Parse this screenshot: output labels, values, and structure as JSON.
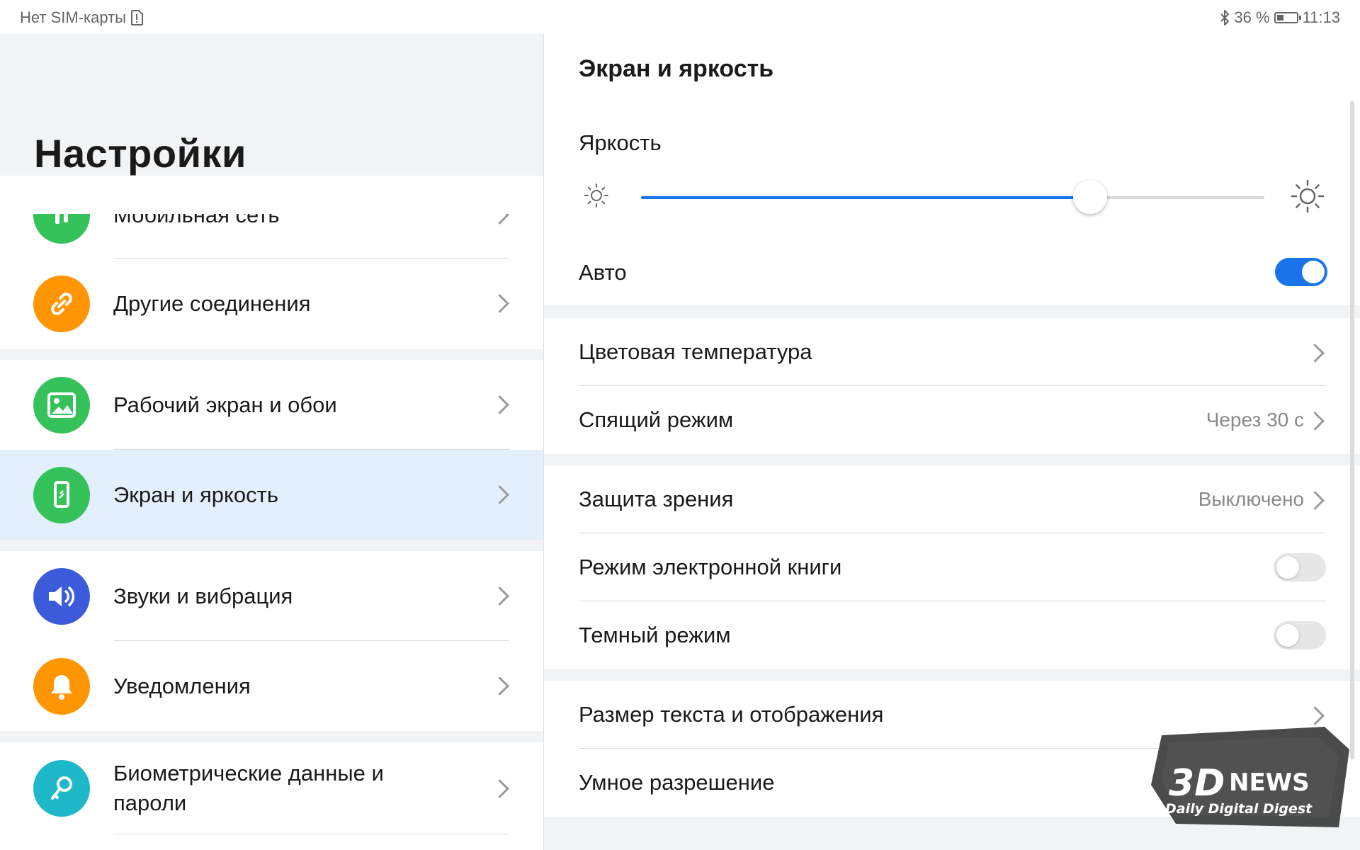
{
  "status": {
    "carrier": "Нет SIM-карты",
    "battery": "36 %",
    "battery_level": 0.36,
    "time": "11:13"
  },
  "left": {
    "title": "Настройки",
    "items": [
      {
        "label": "Мобильная сеть",
        "icon": "mobile-network-icon",
        "color": "#35c25a"
      },
      {
        "label": "Другие соединения",
        "icon": "link-icon",
        "color": "#ff9500"
      },
      {
        "label": "Рабочий экран и обои",
        "icon": "image-icon",
        "color": "#35c25a"
      },
      {
        "label": "Экран и яркость",
        "icon": "phone-display-icon",
        "color": "#35c25a"
      },
      {
        "label": "Звуки и вибрация",
        "icon": "speaker-icon",
        "color": "#3b5bdb"
      },
      {
        "label": "Уведомления",
        "icon": "bell-icon",
        "color": "#ff9500"
      },
      {
        "label": "Биометрические данные и пароли",
        "icon": "key-icon",
        "color": "#1fb8c9"
      }
    ]
  },
  "right": {
    "title": "Экран и яркость",
    "brightness_label": "Яркость",
    "brightness_level": 0.72,
    "auto_label": "Авто",
    "auto_on": true,
    "color_temp": "Цветовая температура",
    "sleep": "Спящий режим",
    "sleep_value": "Через 30 с",
    "eye_protection": "Защита зрения",
    "eye_value": "Выключено",
    "ebook": "Режим электронной книги",
    "dark": "Темный режим",
    "text_size": "Размер текста и отображения",
    "smart_res": "Умное разрешение"
  },
  "colors": {
    "accent": "#1a73e8",
    "active_row": "#e3effc"
  },
  "watermark": {
    "logo": "3DNEWS",
    "tagline": "Daily Digital Digest"
  }
}
